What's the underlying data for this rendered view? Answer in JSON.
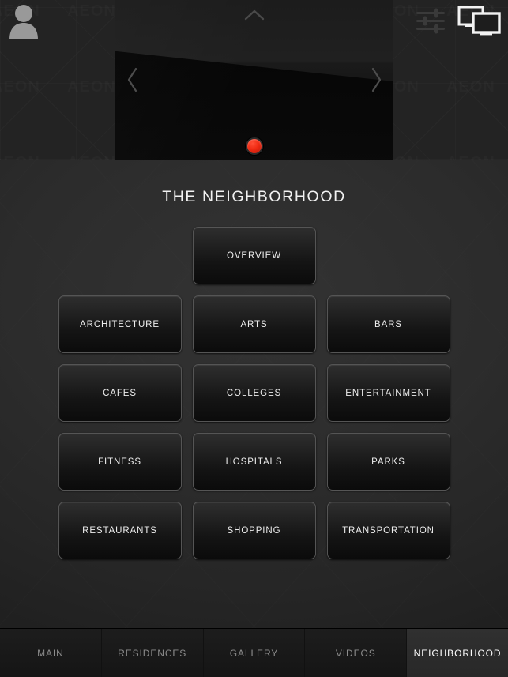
{
  "header": {
    "avatar_icon": "user-avatar-icon",
    "watermark_text": "AEON",
    "tools": [
      {
        "name": "settings-sliders-icon",
        "label": "Settings"
      },
      {
        "name": "screen-mirror-icon",
        "label": "Screen mirror"
      }
    ],
    "video": {
      "collapse_icon": "chevron-up-icon",
      "prev_icon": "chevron-left-icon",
      "next_icon": "chevron-right-icon",
      "record_button": "record-button",
      "record_color": "#ef2a12"
    }
  },
  "main": {
    "title": "THE NEIGHBORHOOD",
    "rows": [
      {
        "tiles": [
          {
            "label": "OVERVIEW"
          }
        ]
      },
      {
        "tiles": [
          {
            "label": "ARCHITECTURE"
          },
          {
            "label": "ARTS"
          },
          {
            "label": "BARS"
          }
        ]
      },
      {
        "tiles": [
          {
            "label": "CAFES"
          },
          {
            "label": "COLLEGES"
          },
          {
            "label": "ENTERTAINMENT"
          }
        ]
      },
      {
        "tiles": [
          {
            "label": "FITNESS"
          },
          {
            "label": "HOSPITALS"
          },
          {
            "label": "PARKS"
          }
        ]
      },
      {
        "tiles": [
          {
            "label": "RESTAURANTS"
          },
          {
            "label": "SHOPPING"
          },
          {
            "label": "TRANSPORTATION"
          }
        ]
      }
    ]
  },
  "tabbar": {
    "tabs": [
      {
        "label": "MAIN",
        "active": false
      },
      {
        "label": "RESIDENCES",
        "active": false
      },
      {
        "label": "GALLERY",
        "active": false
      },
      {
        "label": "VIDEOS",
        "active": false
      },
      {
        "label": "NEIGHBORHOOD",
        "active": true
      }
    ]
  },
  "colors": {
    "accent_red": "#ef2a12",
    "active_tab_bg": "#303030",
    "text_primary": "#ededed",
    "text_muted": "#8d8d8d"
  }
}
